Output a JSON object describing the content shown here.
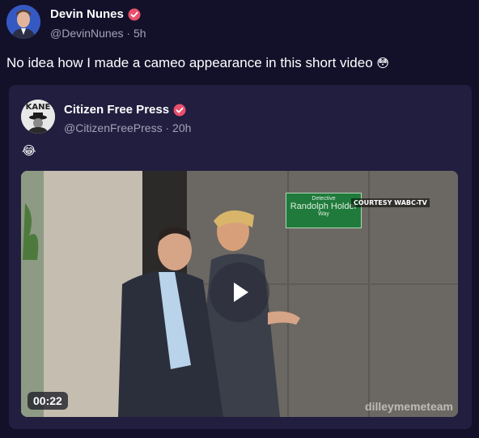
{
  "post": {
    "display_name": "Devin Nunes",
    "handle": "@DevinNunes",
    "time": "5h",
    "text": "No idea how I made a cameo appearance in this short video",
    "emoji": "😳"
  },
  "quote": {
    "display_name": "Citizen Free Press",
    "handle": "@CitizenFreePress",
    "time": "20h",
    "text_emoji": "😂",
    "avatar_text": "KANE",
    "video": {
      "duration": "00:22",
      "watermark": "dilleymemeteam",
      "courtesy": "COURTESY WABC-TV",
      "sign_line1": "Detective",
      "sign_line2": "Randolph Holder",
      "sign_line3": "Way"
    }
  },
  "colors": {
    "background": "#13112a",
    "card": "#211e3f",
    "verified": "#e8506c",
    "muted_text": "#a4a2b8"
  },
  "icons": {
    "verified": "verified-badge-icon",
    "play": "play-icon"
  }
}
